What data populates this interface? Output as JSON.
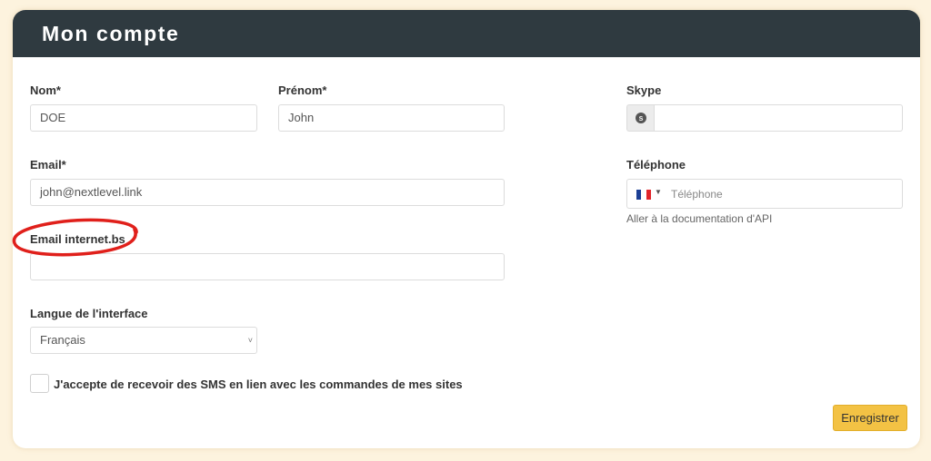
{
  "header": {
    "title": "Mon compte"
  },
  "form": {
    "nom": {
      "label": "Nom*",
      "value": "DOE"
    },
    "prenom": {
      "label": "Prénom*",
      "value": "John"
    },
    "email": {
      "label": "Email*",
      "value": "john@nextlevel.link"
    },
    "email_internet_bs": {
      "label": "Email internet.bs",
      "value": ""
    },
    "langue": {
      "label": "Langue de l'interface",
      "value": "Français"
    },
    "skype": {
      "label": "Skype",
      "value": "",
      "icon": "skype-icon"
    },
    "telephone": {
      "label": "Téléphone",
      "placeholder": "Téléphone",
      "country_flag": "fr-flag-icon",
      "help_text": "Aller à la documentation d'API"
    },
    "sms_consent": {
      "label": "J'accepte de recevoir des SMS en lien avec les commandes de mes sites",
      "checked": false
    }
  },
  "actions": {
    "save_label": "Enregistrer"
  },
  "colors": {
    "background": "#fdf3de",
    "header": "#2f3a40",
    "save_button": "#f3c244",
    "annotation": "#e0201b"
  }
}
